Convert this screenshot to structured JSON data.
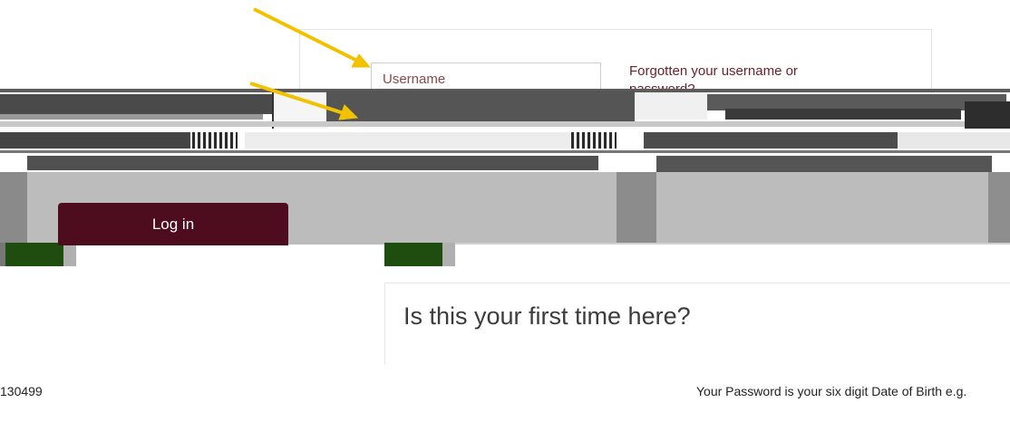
{
  "login": {
    "username_placeholder": "Username",
    "forgot_text": "Forgotten your username or password?",
    "login_button": "Log in"
  },
  "first_time": {
    "title": "Is this your first time here?"
  },
  "footer": {
    "left_text": "130499",
    "right_text": "Your Password is your six digit Date of Birth e.g."
  },
  "colors": {
    "accent": "#4e0d1e",
    "arrow": "#f2c200",
    "link": "#6b1f2a"
  },
  "icons": [
    "arrow-pointer-icon"
  ]
}
